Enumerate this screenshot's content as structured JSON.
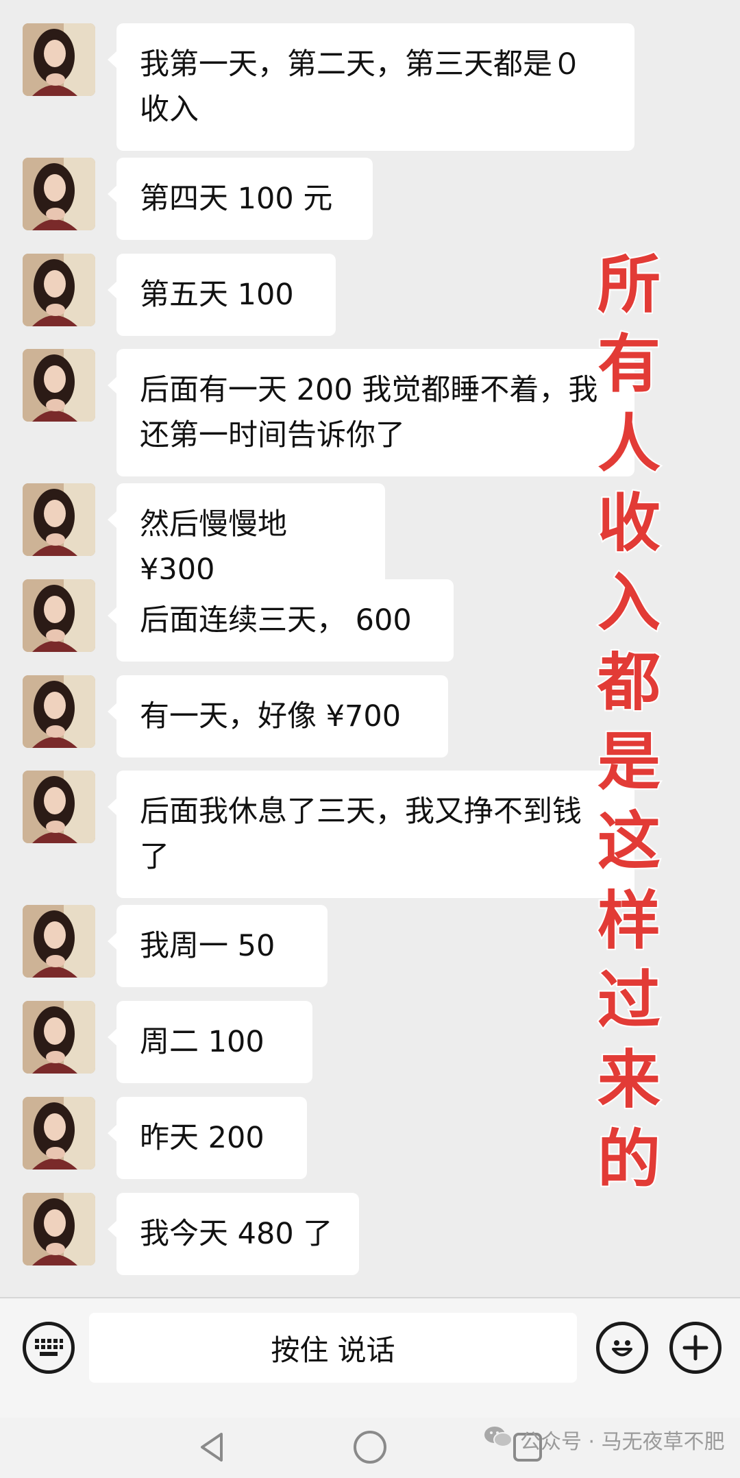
{
  "messages": [
    {
      "text": "我第一天，第二天，第三天都是０\n收入"
    },
    {
      "text": "第四天 100 元"
    },
    {
      "text": "第五天 100"
    },
    {
      "text": "后面有一天 200 我觉都睡不着，我\n还第一时间告诉你了"
    },
    {
      "text": "然后慢慢地 ¥300"
    },
    {
      "text": "后面连续三天， 600"
    },
    {
      "text": "有一天，好像 ¥700"
    },
    {
      "text": "后面我休息了三天，我又挣不到钱\n了"
    },
    {
      "text": "我周一 50"
    },
    {
      "text": "周二 100"
    },
    {
      "text": "昨天 200"
    },
    {
      "text": "我今天 480 了"
    }
  ],
  "overlay": {
    "chars": [
      "所",
      "有",
      "人",
      "收",
      "入",
      "都",
      "是",
      "这",
      "样",
      "过",
      "来",
      "的"
    ],
    "color": "#e23b36"
  },
  "input_bar": {
    "talk_label": "按住 说话",
    "keyboard_icon": "keyboard-icon",
    "emoji_icon": "emoji-icon",
    "plus_icon": "plus-icon"
  },
  "nav": {
    "back_icon": "back-triangle-icon",
    "home_icon": "home-circle-icon",
    "recents_icon": "recents-square-icon"
  },
  "watermark": {
    "text": "公众号 · 马无夜草不肥",
    "icon": "wechat-icon"
  },
  "colors": {
    "chat_background": "#ededed",
    "bubble": "#ffffff",
    "text": "#111111"
  }
}
